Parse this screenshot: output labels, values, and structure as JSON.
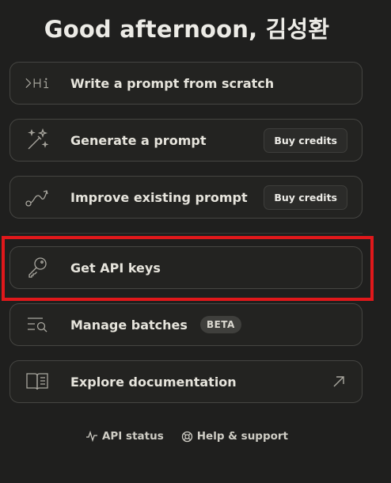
{
  "greeting": "Good afternoon, 김성환",
  "actions": {
    "write": {
      "label": "Write a prompt from scratch",
      "icon": "terminal-hi-icon"
    },
    "generate": {
      "label": "Generate a prompt",
      "button": "Buy credits",
      "icon": "magic-wand-icon"
    },
    "improve": {
      "label": "Improve existing prompt",
      "button": "Buy credits",
      "icon": "curve-path-icon"
    },
    "api_keys": {
      "label": "Get API keys",
      "icon": "key-icon"
    },
    "batches": {
      "label": "Manage batches",
      "badge": "BETA",
      "icon": "list-search-icon"
    },
    "docs": {
      "label": "Explore documentation",
      "icon": "book-icon",
      "trailing_icon": "arrow-up-right-icon"
    }
  },
  "footer": {
    "api_status": "API status",
    "help": "Help & support"
  },
  "colors": {
    "background": "#1f1f1e",
    "card_border": "#454542",
    "highlight": "#e0181b"
  }
}
